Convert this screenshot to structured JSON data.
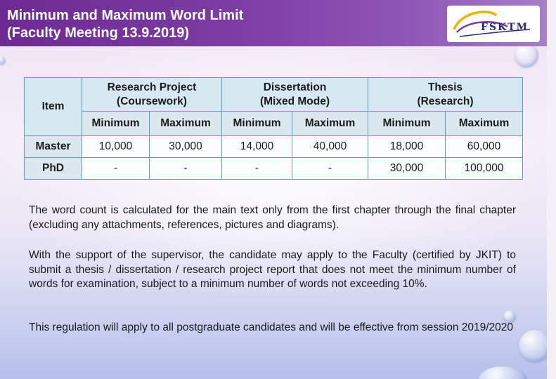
{
  "slide": {
    "title_line1": "Minimum and Maximum Word Limit",
    "title_line2": "(Faculty Meeting 13.9.2019)",
    "logo_text": "FSKTM"
  },
  "table": {
    "item_header": "Item",
    "groups": [
      {
        "line1": "Research Project",
        "line2": "(Coursework)"
      },
      {
        "line1": "Dissertation",
        "line2": "(Mixed Mode)"
      },
      {
        "line1": "Thesis",
        "line2": "(Research)"
      }
    ],
    "sub_headers": [
      "Minimum",
      "Maximum",
      "Minimum",
      "Maximum",
      "Minimum",
      "Maximum"
    ],
    "rows": [
      {
        "label": "Master",
        "cells": [
          "10,000",
          "30,000",
          "14,000",
          "40,000",
          "18,000",
          "60,000"
        ]
      },
      {
        "label": "PhD",
        "cells": [
          "-",
          "-",
          "-",
          "-",
          "30,000",
          "100,000"
        ]
      }
    ]
  },
  "notes": [
    "The word count is calculated for the main text only from the first chapter through the final chapter (excluding any attachments, references, pictures and diagrams).",
    "With the support of the supervisor, the candidate may apply to the Faculty (certified by JKIT) to submit a thesis / dissertation / research project report that does not meet the minimum number of words for examination, subject to a minimum number of words  not exceeding 10%.",
    "This regulation will apply to all postgraduate candidates and will be effective from session 2019/2020"
  ]
}
